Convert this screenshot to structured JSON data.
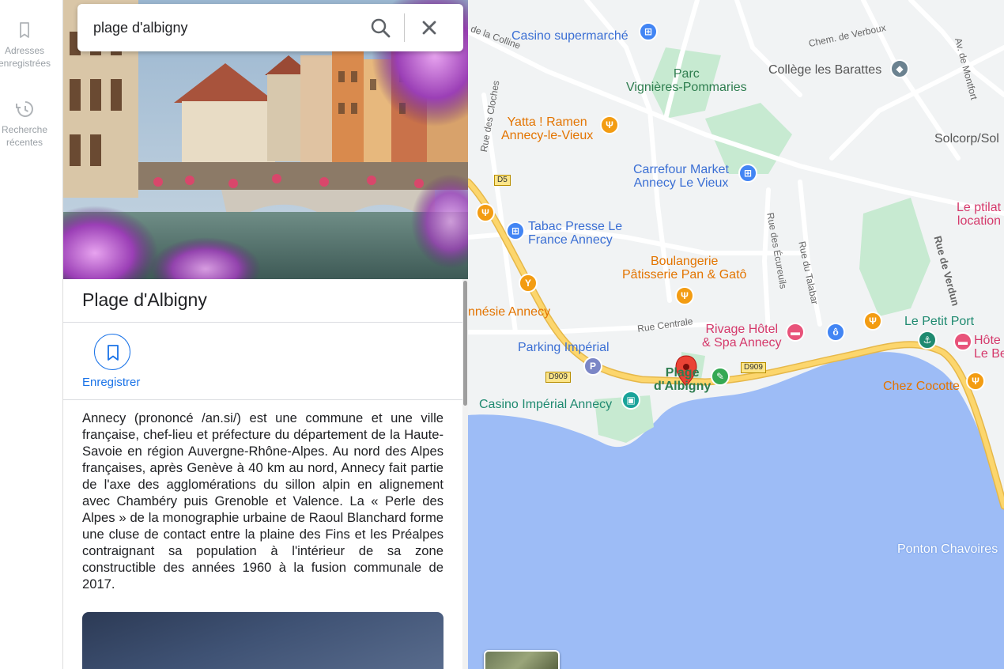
{
  "rail": {
    "saved": {
      "label": "Adresses enregistrées",
      "icon": "bookmark-outline-icon"
    },
    "recent": {
      "label": "Recherche récentes",
      "icon": "history-icon"
    }
  },
  "search": {
    "value": "plage d'albigny"
  },
  "place": {
    "title": "Plage d'Albigny",
    "save_label": "Enregistrer",
    "description": "Annecy (prononcé /an.si/) est une commune et une ville française, chef-lieu et préfecture du département de la Haute-Savoie en région Auvergne-Rhône-Alpes. Au nord des Alpes françaises, après Genève à 40 km au nord, Annecy fait partie de l'axe des agglomérations du sillon alpin en alignement avec Chambéry puis Grenoble et Valence. La « Perle des Alpes » de la monographie urbaine de Raoul Blanchard forme une cluse de contact entre la plaine des Fins et les Préalpes contraignant sa population à l'intérieur de sa zone constructible des années 1960 à la fusion communale de 2017."
  },
  "map": {
    "labels": {
      "casino_super": "Casino supermarché",
      "colline": "de la Colline",
      "verboux": "Chem. de Verboux",
      "montfort": "Av. de Montfort",
      "parc": "Parc\nVignières-Pommaries",
      "college": "Collège les Barattes",
      "cloches": "Rue des Cloches",
      "yatta": "Yatta ! Ramen\nAnnecy-le-Vieux",
      "solcorp": "Solcorp/Sol",
      "carrefour": "Carrefour Market\nAnnecy Le Vieux",
      "pitlat": "Le ptilat\nlocation",
      "tabac": "Tabac Presse Le\nFrance Annecy",
      "ecureuils": "Rue des Écureuils",
      "talabar": "Rue du Talabar",
      "verdun": "Rue de Verdun",
      "boulangerie": "Boulangerie\nPâtisserie Pan & Gatô",
      "annesie": "nnésie Annecy",
      "centrale": "Rue Centrale",
      "rivage": "Rivage Hôtel\n& Spa Annecy",
      "petit_port": "Le Petit Port",
      "hotel_right": "Hôte\nLe Be",
      "parking": "Parking Impérial",
      "plage": "Plage\nd'Albigny",
      "chez_cocotte": "Chez Cocotte",
      "casino_imperial": "Casino Impérial Annecy",
      "ponton": "Ponton Chavoires",
      "d5": "D5",
      "d909a": "D909",
      "d909b": "D909"
    },
    "colors": {
      "water": "#9dbcf6",
      "park": "#c7ead1",
      "road_major": "#fcd66d",
      "road_minor": "#ffffff",
      "pin": "#ea4335"
    }
  }
}
